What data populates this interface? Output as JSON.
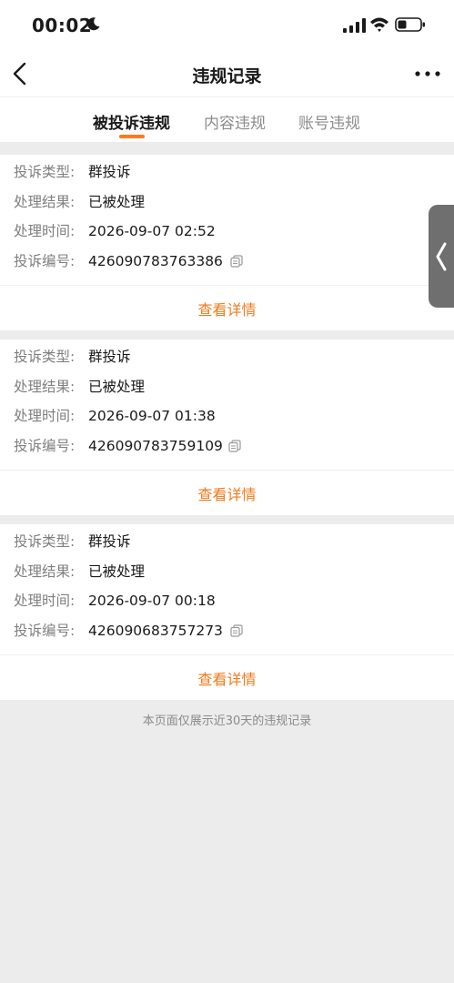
{
  "status_bar": {
    "time": "00:02"
  },
  "nav": {
    "title": "违规记录"
  },
  "tabs": [
    {
      "label": "被投诉违规"
    },
    {
      "label": "内容违规"
    },
    {
      "label": "账号违规"
    }
  ],
  "field_labels": {
    "type": "投诉类型:",
    "result": "处理结果:",
    "time": "处理时间:",
    "id": "投诉编号:"
  },
  "records": [
    {
      "type": "群投诉",
      "result": "已被处理",
      "time": "2026-09-07 02:52",
      "id": "426090783763386",
      "detail_label": "查看详情"
    },
    {
      "type": "群投诉",
      "result": "已被处理",
      "time": "2026-09-07 01:38",
      "id": "426090783759109",
      "detail_label": "查看详情"
    },
    {
      "type": "群投诉",
      "result": "已被处理",
      "time": "2026-09-07 00:18",
      "id": "426090683757273",
      "detail_label": "查看详情"
    }
  ],
  "footer": {
    "note": "本页面仅展示近30天的违规记录"
  },
  "colors": {
    "accent": "#f07a1c",
    "tab_indicator": "#ff7a1a",
    "background": "#ececec"
  }
}
